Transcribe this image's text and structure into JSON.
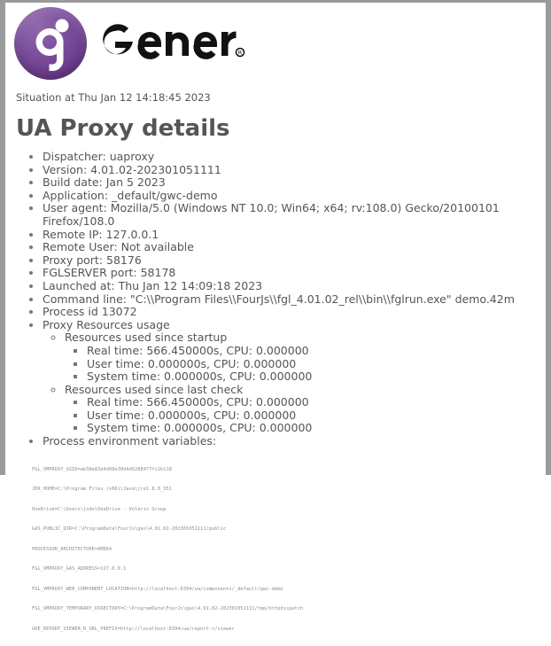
{
  "branding": {
    "logo_mark_name": "genero-g-logo",
    "wordmark": "genero",
    "wordmark_trademark": "®",
    "logo_color": "#6f3f91"
  },
  "header": {
    "situation": "Situation at Thu Jan 12 14:18:45 2023",
    "title": "UA Proxy details"
  },
  "details": [
    "Dispatcher: uaproxy",
    "Version: 4.01.02-202301051111",
    "Build date: Jan 5 2023",
    "Application: _default/gwc-demo",
    "User agent: Mozilla/5.0 (Windows NT 10.0; Win64; x64; rv:108.0) Gecko/20100101 Firefox/108.0",
    "Remote IP: 127.0.0.1",
    "Remote User: Not available",
    "Proxy port: 58176",
    "FGLSERVER port: 58178",
    "Launched at: Thu Jan 12 14:09:18 2023",
    "Command line: \"C:\\\\Program Files\\\\FourJs\\\\fgl_4.01.02_rel\\\\bin\\\\fglrun.exe\" demo.42m",
    "Process id 13072"
  ],
  "resources": {
    "label": "Proxy Resources usage",
    "groups": [
      {
        "label": "Resources used since startup",
        "items": [
          "Real time: 566.450000s, CPU: 0.000000",
          "User time: 0.000000s, CPU: 0.000000",
          "System time: 0.000000s, CPU: 0.000000"
        ]
      },
      {
        "label": "Resources used since last check",
        "items": [
          "Real time: 566.450000s, CPU: 0.000000",
          "User time: 0.000000s, CPU: 0.000000",
          "System time: 0.000000s, CPU: 0.000000"
        ]
      }
    ]
  },
  "environment": {
    "label": "Process environment variables:",
    "lines": [
      "FGL_VMPROXY_GSID=ab38e83d4d08e39d4d5288477fc2b118",
      "JDK_HOME=C:\\Program Files (x86)\\Java\\jre1.8.0_351",
      "OneDrive=C:\\Users\\jodo\\OneDrive - Volaris Group",
      "GAS_PUBLIC_DIR=C:\\ProgramData\\FourJs\\gas\\4.01.02-202301051111/public",
      "PROCESSOR_ARCHITECTURE=AMD64",
      "FGL_VMPROXY_GAS_ADDRESS=127.0.0.1",
      "FGL_VMPROXY_WEB_COMPONENT_LOCATION=http://localhost:6394/ua/components/_default/gwc-demo",
      "FGL_VMPROXY_TEMPORARY_DIRECTORY=C:\\ProgramData\\FourJs\\gas\\4.01.02-202301051111/tmp/httpdispatch",
      "GRE_REPORT_VIEWER_R_URL_PREFIX=http://localhost:6394/ua/report-r/viewer"
    ]
  }
}
